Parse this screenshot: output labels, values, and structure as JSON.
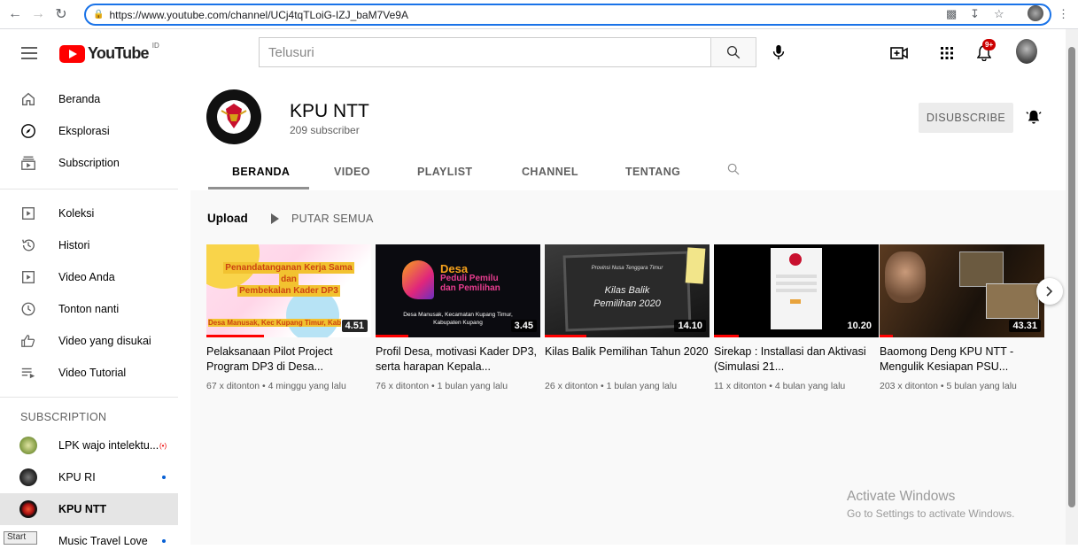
{
  "browser": {
    "url": "https://www.youtube.com/channel/UCj4tqTLoiG-IZJ_baM7Ve9A"
  },
  "masthead": {
    "logo_text": "YouTube",
    "region": "ID",
    "search_placeholder": "Telusuri",
    "notifications_badge": "9+"
  },
  "sidebar": {
    "main": [
      {
        "label": "Beranda",
        "icon": "home-icon"
      },
      {
        "label": "Eksplorasi",
        "icon": "compass-icon"
      },
      {
        "label": "Subscription",
        "icon": "subscriptions-icon"
      }
    ],
    "library": [
      {
        "label": "Koleksi",
        "icon": "library-icon"
      },
      {
        "label": "Histori",
        "icon": "history-icon"
      },
      {
        "label": "Video Anda",
        "icon": "your-videos-icon"
      },
      {
        "label": "Tonton nanti",
        "icon": "watch-later-icon"
      },
      {
        "label": "Video yang disukai",
        "icon": "thumbs-up-icon"
      },
      {
        "label": "Video Tutorial",
        "icon": "playlist-icon"
      }
    ],
    "subscription_heading": "SUBSCRIPTION",
    "subscriptions": [
      {
        "label": "LPK wajo intelektu...",
        "indicator": "live"
      },
      {
        "label": "KPU RI",
        "indicator": "new"
      },
      {
        "label": "KPU NTT",
        "indicator": "none"
      },
      {
        "label": "Music Travel Love",
        "indicator": "new"
      }
    ]
  },
  "channel": {
    "name": "KPU NTT",
    "subscribers": "209 subscriber",
    "unsubscribe_label": "DISUBSCRIBE",
    "tabs": [
      "BERANDA",
      "VIDEO",
      "PLAYLIST",
      "CHANNEL",
      "TENTANG"
    ],
    "active_tab": "BERANDA"
  },
  "uploads": {
    "label": "Upload",
    "play_all": "PUTAR SEMUA",
    "videos": [
      {
        "title": "Pelaksanaan Pilot Project Program DP3 di Desa...",
        "meta": "67 x ditonton • 4 minggu yang lalu",
        "duration": "4.51",
        "watched_fraction": 0.35,
        "thumb_lines": [
          "Penandatanganan Kerja Sama",
          "dan",
          "Pembekalan Kader DP3",
          "Desa Manusak, Kec Kupang Timur, Kab. Kupang"
        ]
      },
      {
        "title": "Profil Desa, motivasi Kader DP3, serta harapan Kepala...",
        "meta": "76 x ditonton • 1 bulan yang lalu",
        "duration": "3.45",
        "watched_fraction": 0.2,
        "thumb_lines": [
          "Desa",
          "Peduli Pemilu",
          "dan Pemilihan",
          "Desa Manusak, Kecamatan Kupang Timur,",
          "Kabupaten Kupang"
        ]
      },
      {
        "title": "Kilas Balik Pemilihan Tahun 2020",
        "meta": "26 x ditonton • 1 bulan yang lalu",
        "duration": "14.10",
        "watched_fraction": 0.25,
        "thumb_lines": [
          "Provinsi Nusa Tenggara Timur",
          "Kilas Balik",
          "Pemilihan 2020"
        ]
      },
      {
        "title": "Sirekap : Installasi dan Aktivasi (Simulasi 21...",
        "meta": "11 x ditonton • 4 bulan yang lalu",
        "duration": "10.20",
        "watched_fraction": 0.15,
        "thumb_lines": []
      },
      {
        "title": "Baomong Deng KPU NTT - Mengulik Kesiapan PSU...",
        "meta": "203 x ditonton • 5 bulan yang lalu",
        "duration": "43.31",
        "watched_fraction": 0.08,
        "thumb_lines": []
      }
    ]
  },
  "windows": {
    "watermark_title": "Activate Windows",
    "watermark_sub": "Go to Settings to activate Windows.",
    "start_label": "Start"
  },
  "colors": {
    "brand_red": "#ff0000",
    "progress_red": "#ff0000",
    "link_blue": "#065fd4"
  }
}
